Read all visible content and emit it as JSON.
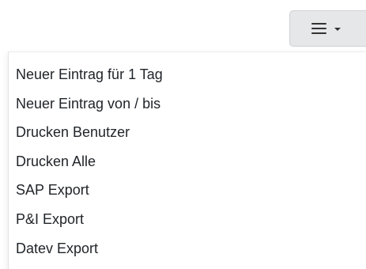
{
  "toolbar": {
    "menu_button_icon": "hamburger-icon",
    "caret_icon": "caret-down-icon"
  },
  "menu": {
    "items": [
      {
        "label": "Neuer Eintrag für 1 Tag"
      },
      {
        "label": "Neuer Eintrag von / bis"
      },
      {
        "label": "Drucken Benutzer"
      },
      {
        "label": "Drucken Alle"
      },
      {
        "label": "SAP Export"
      },
      {
        "label": "P&I Export"
      },
      {
        "label": "Datev Export"
      }
    ]
  },
  "colors": {
    "button_bg": "#e6e7e9",
    "text": "#212529"
  }
}
